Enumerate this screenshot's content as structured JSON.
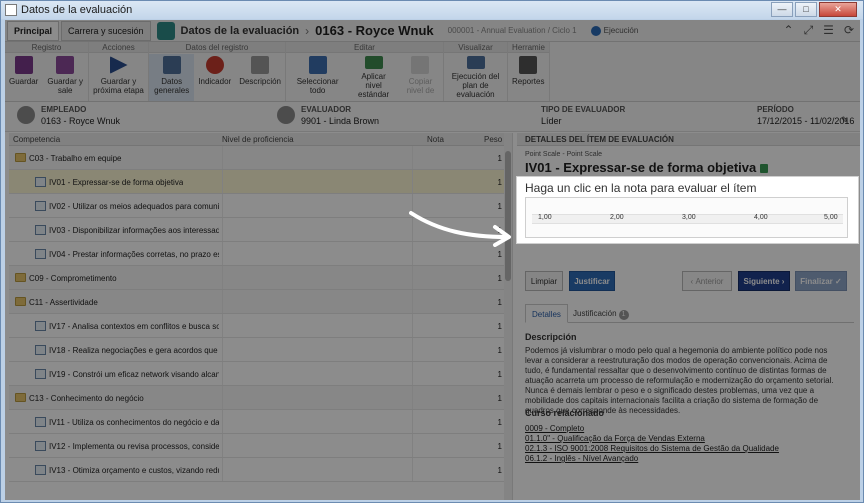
{
  "window": {
    "title": "Datos de la evaluación"
  },
  "header": {
    "tabs": [
      "Principal",
      "Carrera y sucesión"
    ],
    "crumb1": "Datos de la evaluación",
    "crumb2": "0163 - Royce Wnuk",
    "subtitle": "000001 - Annual Evaluation / Ciclo 1",
    "exec": "Ejecución"
  },
  "ribbon": {
    "groups": [
      {
        "title": "Registro",
        "buttons": [
          "Guardar",
          "Guardar y sale"
        ]
      },
      {
        "title": "Acciones",
        "buttons": [
          "Guardar y próxima etapa"
        ]
      },
      {
        "title": "Datos del registro",
        "buttons": [
          "Datos generales",
          "Indicador",
          "Descripción"
        ]
      },
      {
        "title": "Editar",
        "buttons": [
          "Seleccionar todo",
          "Aplicar nivel estándar",
          "Copiar nivel de"
        ]
      },
      {
        "title": "Visualizar",
        "buttons": [
          "Ejecución del plan de evaluación"
        ]
      },
      {
        "title": "Herramie",
        "buttons": [
          "Reportes"
        ]
      }
    ]
  },
  "employee_bar": {
    "empleado_label": "EMPLEADO",
    "empleado": "0163 - Royce Wnuk",
    "evaluador_label": "EVALUADOR",
    "evaluador": "9901 - Linda Brown",
    "tipo_label": "TIPO DE EVALUADOR",
    "tipo": "Líder",
    "periodo_label": "PERÍODO",
    "periodo": "17/12/2015 - 11/02/2016"
  },
  "table": {
    "columns": [
      "Competencia",
      "Nivel de proficiencia",
      "Nota",
      "Peso"
    ],
    "rows": [
      {
        "kind": "comp",
        "text": "C03 - Trabalho em equipe",
        "peso": "1"
      },
      {
        "kind": "item",
        "text": "IV01 - Expressar-se de forma objetiva",
        "peso": "1",
        "selected": true
      },
      {
        "kind": "item",
        "text": "IV02 - Utilizar os meios adequados para comuni...",
        "peso": "1"
      },
      {
        "kind": "item",
        "text": "IV03 - Disponibilizar informações aos interessados",
        "peso": "1"
      },
      {
        "kind": "item",
        "text": "IV04 - Prestar informações corretas, no prazo est...",
        "peso": "1"
      },
      {
        "kind": "comp",
        "text": "C09 - Comprometimento",
        "peso": "1"
      },
      {
        "kind": "comp",
        "text": "C11 - Assertividade",
        "peso": "1"
      },
      {
        "kind": "item",
        "text": "IV17 - Analisa contextos em conflitos e busca sol...",
        "peso": "1"
      },
      {
        "kind": "item",
        "text": "IV18 - Realiza negociações e gera acordos que ...",
        "peso": "1"
      },
      {
        "kind": "item",
        "text": "IV19 - Constrói um eficaz network visando alcan...",
        "peso": "1"
      },
      {
        "kind": "comp",
        "text": "C13 - Conhecimento do negócio",
        "peso": "1"
      },
      {
        "kind": "item",
        "text": "IV11 - Utiliza os conhecimentos do negócio e da...",
        "peso": "1"
      },
      {
        "kind": "item",
        "text": "IV12 - Implementa ou revisa processos, consider...",
        "peso": "1"
      },
      {
        "kind": "item",
        "text": "IV13 - Otimiza orçamento e custos, vizando redu...",
        "peso": "1"
      }
    ]
  },
  "detail": {
    "title": "DETALLES DEL ÍTEM DE EVALUACIÓN",
    "scale_label": "Point Scale - Point Scale",
    "item_title": "IV01 - Expressar-se de forma objetiva",
    "rate_prompt": "Haga un clic en la nota para evaluar el ítem",
    "ticks": [
      "1,00",
      "2,00",
      "3,00",
      "4,00",
      "5,00"
    ],
    "buttons": {
      "limpiar": "Limpiar",
      "justificar": "Justificar",
      "anterior": "Anterior",
      "siguiente": "Siguiente",
      "finalizar": "Finalizar"
    },
    "tabs": {
      "detalles": "Detalles",
      "justificacion": "Justificación",
      "justificacion_count": "1"
    },
    "description_title": "Descripción",
    "description": "Podemos já vislumbrar o modo pelo qual a hegemonia do ambiente político pode nos levar a considerar a reestruturação dos modos de operação convencionais. Acima de tudo, é fundamental ressaltar que o desenvolvimento contínuo de distintas formas de atuação acarreta um processo de reformulação e modernização do orçamento setorial. Nunca é demais lembrar o peso e o significado destes problemas, uma vez que a mobilidade dos capitais internacionais facilita a criação do sistema de formação de quadros que corresponde às necessidades.",
    "course_title": "Curso relacionado",
    "courses": [
      "0009 - Completo",
      "01.1.0\" - Qualificação da Força de Vendas Externa",
      "02.1.3 - ISO 9001:2008 Requisitos do Sistema de Gestão da Qualidade",
      "06.1.2 - Inglês - Nível Avançado"
    ]
  }
}
